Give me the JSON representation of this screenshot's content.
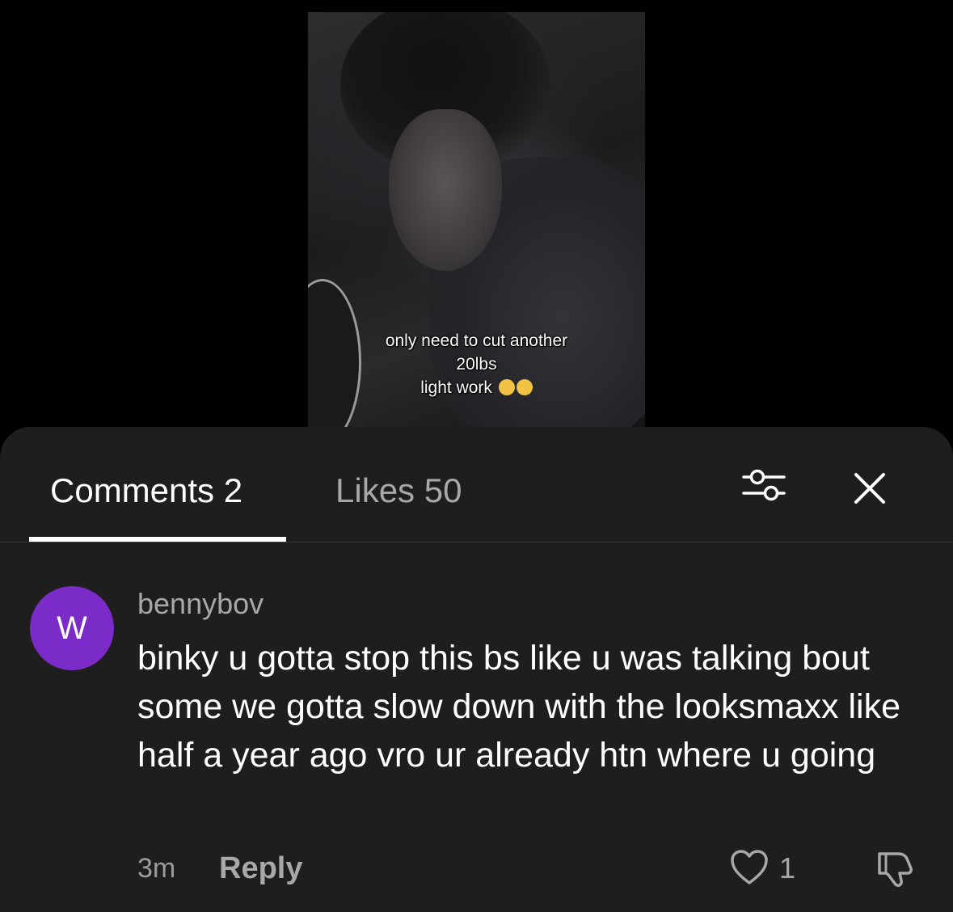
{
  "video": {
    "caption_lines": [
      "only need to cut another",
      "20lbs",
      "light work"
    ]
  },
  "tabs": {
    "comments_label": "Comments 2",
    "likes_label": "Likes 50"
  },
  "icons": {
    "filter": "sliders-icon",
    "close": "close-icon",
    "like": "heart-icon",
    "dislike": "thumbs-down-icon"
  },
  "comment": {
    "avatar_letter": "W",
    "avatar_color": "#7b2bc8",
    "username": "bennybov",
    "text": "binky u gotta stop this bs like u was talking bout some we gotta slow down with the looksmaxx like half a year ago vro ur already htn where u going",
    "time": "3m",
    "reply_label": "Reply",
    "like_count": "1"
  }
}
